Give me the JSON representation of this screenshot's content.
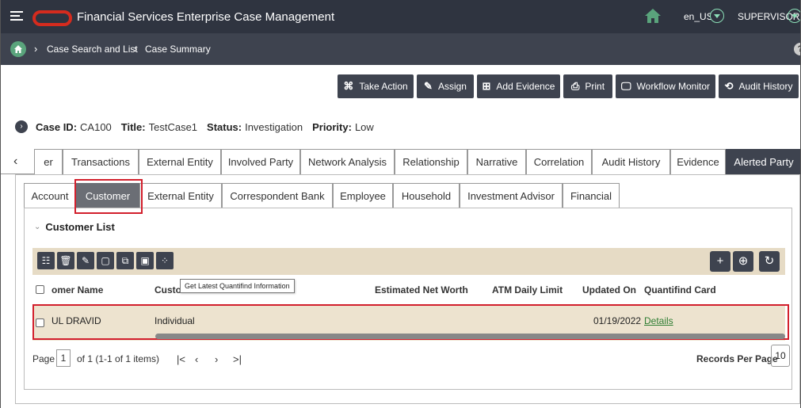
{
  "header": {
    "app_title": "Financial Services Enterprise Case Management",
    "locale": "en_US",
    "user": "SUPERVISOR",
    "brand_color": "#d52b1e"
  },
  "breadcrumb": {
    "items": [
      "Case Search and List",
      "Case Summary"
    ],
    "separator": "›"
  },
  "actions": [
    {
      "label": "Take Action",
      "icon": "command-icon"
    },
    {
      "label": "Assign",
      "icon": "pencil-icon"
    },
    {
      "label": "Add Evidence",
      "icon": "plus-box-icon"
    },
    {
      "label": "Print",
      "icon": "printer-icon"
    },
    {
      "label": "Workflow Monitor",
      "icon": "monitor-icon"
    },
    {
      "label": "Audit History",
      "icon": "history-icon"
    }
  ],
  "case": {
    "id_label": "Case ID:",
    "id": "CA100",
    "title_label": "Title:",
    "title": "TestCase1",
    "status_label": "Status:",
    "status": "Investigation",
    "priority_label": "Priority:",
    "priority": "Low"
  },
  "top_tabs": [
    "er",
    "Transactions",
    "External Entity",
    "Involved Party",
    "Network Analysis",
    "Relationship",
    "Narrative",
    "Correlation",
    "Audit History",
    "Evidence",
    "Alerted Party"
  ],
  "top_tabs_active": "Alerted Party",
  "sub_tabs": [
    "Account",
    "Customer",
    "External Entity",
    "Correspondent Bank",
    "Employee",
    "Household",
    "Investment Advisor",
    "Financial"
  ],
  "sub_tabs_active": "Customer",
  "customer_list": {
    "title": "Customer List",
    "tooltip": "Get Latest Quantifind Information",
    "columns": [
      "omer Name",
      "Custome",
      "Estimated Net Worth",
      "ATM Daily Limit",
      "Updated On",
      "Quantifind Card"
    ],
    "rows": [
      {
        "name": "UL DRAVID",
        "type": "Individual",
        "net_worth": "",
        "atm_limit": "",
        "updated_on": "01/19/2022",
        "card": "Details"
      }
    ]
  },
  "pager": {
    "page_label": "Page",
    "page": "1",
    "summary": "of 1 (1-1 of 1 items)",
    "records_label": "Records Per Page",
    "records": "10"
  }
}
